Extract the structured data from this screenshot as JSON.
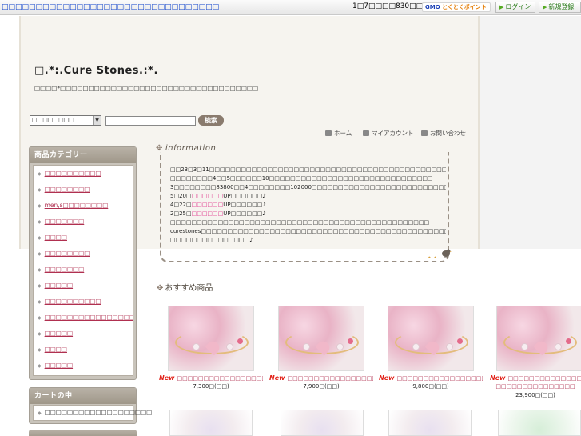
{
  "topbar": {
    "promo_link": "□□□□□□□□□□□□□□□□□□□□□□□□□□□□□□□□",
    "points_text": "1□7□□□□830□□□□□□□□",
    "gmo_logo_text": "GMO",
    "gmo_logo_sub": "とくとくポイント",
    "login_label": "ログイン",
    "register_label": "新規登録"
  },
  "header": {
    "shop_title": "□.*:.Cure Stones.:*.",
    "shop_desc": "□□□□*□□□□□□□□□□□□□□□□□□□□□□□□□□□□□□□□□□□"
  },
  "search": {
    "category_selected": "□□□□□□□□",
    "input_value": "",
    "button_label": "検索"
  },
  "nav": {
    "home": "ホーム",
    "mypage": "マイアカウント",
    "contact": "お問い合わせ"
  },
  "sidebar": {
    "category_header": "商品カテゴリー",
    "categories": [
      "□□□□□□□□□□",
      "□□□□□□□□",
      "men,s□□□□□□□□",
      "□□□□□□□",
      "□□□□",
      "□□□□□□□□",
      "□□□□□□□",
      "□□□□□",
      "□□□□□□□□□□",
      "□□□□□□□□□□□□□□□□",
      "□□□□□",
      "□□□□",
      "□□□□□"
    ],
    "cart_header": "カートの中",
    "cart_text": "□□□□□□□□□□□□□□□□□□□"
  },
  "information": {
    "title": "information",
    "lines": [
      "□□23□3□11□□□□□□□□□□□□□□□□□□□□□□□□□□□□□□□□□□□□□□□□□□□□□□□□□□",
      "□□□□□□□□4□□5□□□□□□10□□□□□□□□□□□□□□□□□□□□□□□□□□□□□□□",
      "3□□□□□□□□83800□□4□□□□□□□□102000□□□□□□□□□□□□□□□□□□□□□□□□□□□□□",
      [
        "5□20□",
        "□□□□□□",
        "UP□□□□□□♪"
      ],
      [
        "4□22□",
        "□□□□□□",
        "UP□□□□□□♪"
      ],
      [
        "2□25□",
        "□□□□□□",
        "UP□□□□□□♪"
      ],
      "□□□□□□□□□□□□□□□□□□□□□□□□□□□□□□□□□□□□□□□□□□□□□□□□□",
      "curestones□□□□□□□□□□□□□□□□□□□□□□□□□□□□□□□□□□□□□□□□□□□□□□□□",
      "□□□□□□□□□□□□□□□♪"
    ]
  },
  "recommended": {
    "title": "おすすめ商品",
    "products": [
      {
        "badge": "New",
        "name": "□□□□□□□□□□□□□□□□□□□□□",
        "price": "7,300□(□□)"
      },
      {
        "badge": "New",
        "name": "□□□□□□□□□□□□□□□□□□□□□",
        "price": "7,900□(□□)"
      },
      {
        "badge": "New",
        "name": "□□□□□□□□□□□□□□□□□□□□□",
        "price": "9,800□(□□)"
      },
      {
        "badge": "New",
        "name": "□□□□□□□□□□□□□□ □□□□□□□□□□□□□□□",
        "price": "23,900□(□□)"
      }
    ]
  },
  "colors": {
    "link_blue": "#1144cc",
    "category_pink": "#b03050",
    "highlight_pink": "#e0308a",
    "new_red": "#e2231a",
    "sidebar_brown": "#9f9789"
  }
}
